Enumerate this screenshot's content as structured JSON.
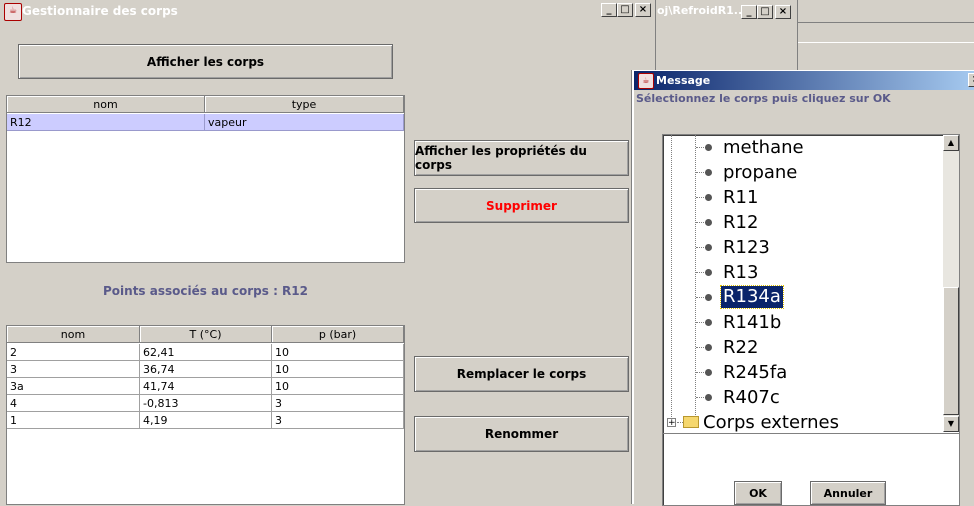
{
  "main_window": {
    "title": "Gestionnaire des corps",
    "show_button": "Afficher les corps",
    "properties_button": "Afficher les propriétés du corps",
    "delete_button": "Supprimer",
    "replace_button": "Remplacer le corps",
    "rename_button": "Renommer",
    "points_label": "Points associés au corps : R12",
    "corps_table": {
      "headers": [
        "nom",
        "type"
      ],
      "rows": [
        [
          "R12",
          "vapeur"
        ]
      ]
    },
    "points_table": {
      "headers": [
        "nom",
        "T (°C)",
        "p (bar)"
      ],
      "rows": [
        [
          "2",
          "62,41",
          "10"
        ],
        [
          "3",
          "36,74",
          "10"
        ],
        [
          "3a",
          "41,74",
          "10"
        ],
        [
          "4",
          "-0,813",
          "3"
        ],
        [
          "1",
          "4,19",
          "3"
        ]
      ]
    }
  },
  "bg_window": {
    "title": "oj\\RefroidR1..."
  },
  "dialog": {
    "title": "Message",
    "prompt": "Sélectionnez le corps puis cliquez sur OK",
    "tree_items": [
      "methane",
      "propane",
      "R11",
      "R12",
      "R123",
      "R13",
      "R134a",
      "R141b",
      "R22",
      "R245fa",
      "R407c"
    ],
    "selected_item": "R134a",
    "folder_label": "Corps externes",
    "ok_button": "OK",
    "cancel_button": "Annuler"
  },
  "colors": {
    "selection_row": "#ccccff",
    "selection_tree": "#0a246a",
    "label_blue": "#5a5a8a",
    "delete_red": "#ff0000"
  }
}
